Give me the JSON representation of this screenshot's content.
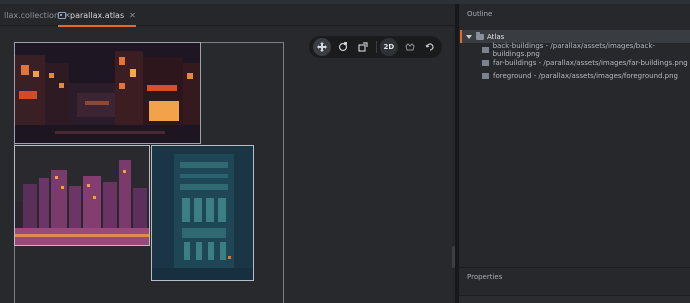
{
  "tabs": [
    {
      "label": "llax.collection",
      "close": "✕"
    },
    {
      "label": "parallax.atlas",
      "close": "✕"
    }
  ],
  "toolbar": {
    "move_icon": "move-icon",
    "rotate_icon": "rotate-icon",
    "scale_icon": "scale-icon",
    "mode_2d": "2D",
    "visibility_icon": "visibility-icon",
    "camera_icon": "camera-icon"
  },
  "outline": {
    "title": "Outline",
    "root": "Atlas",
    "items": [
      "back-buildings - /parallax/assets/images/back-buildings.png",
      "far-buildings - /parallax/assets/images/far-buildings.png",
      "foreground - /parallax/assets/images/foreground.png"
    ]
  },
  "properties": {
    "title": "Properties"
  },
  "colors": {
    "accent": "#e26b2c",
    "editor_bg": "#25272a",
    "panel_bg": "#26282b"
  }
}
